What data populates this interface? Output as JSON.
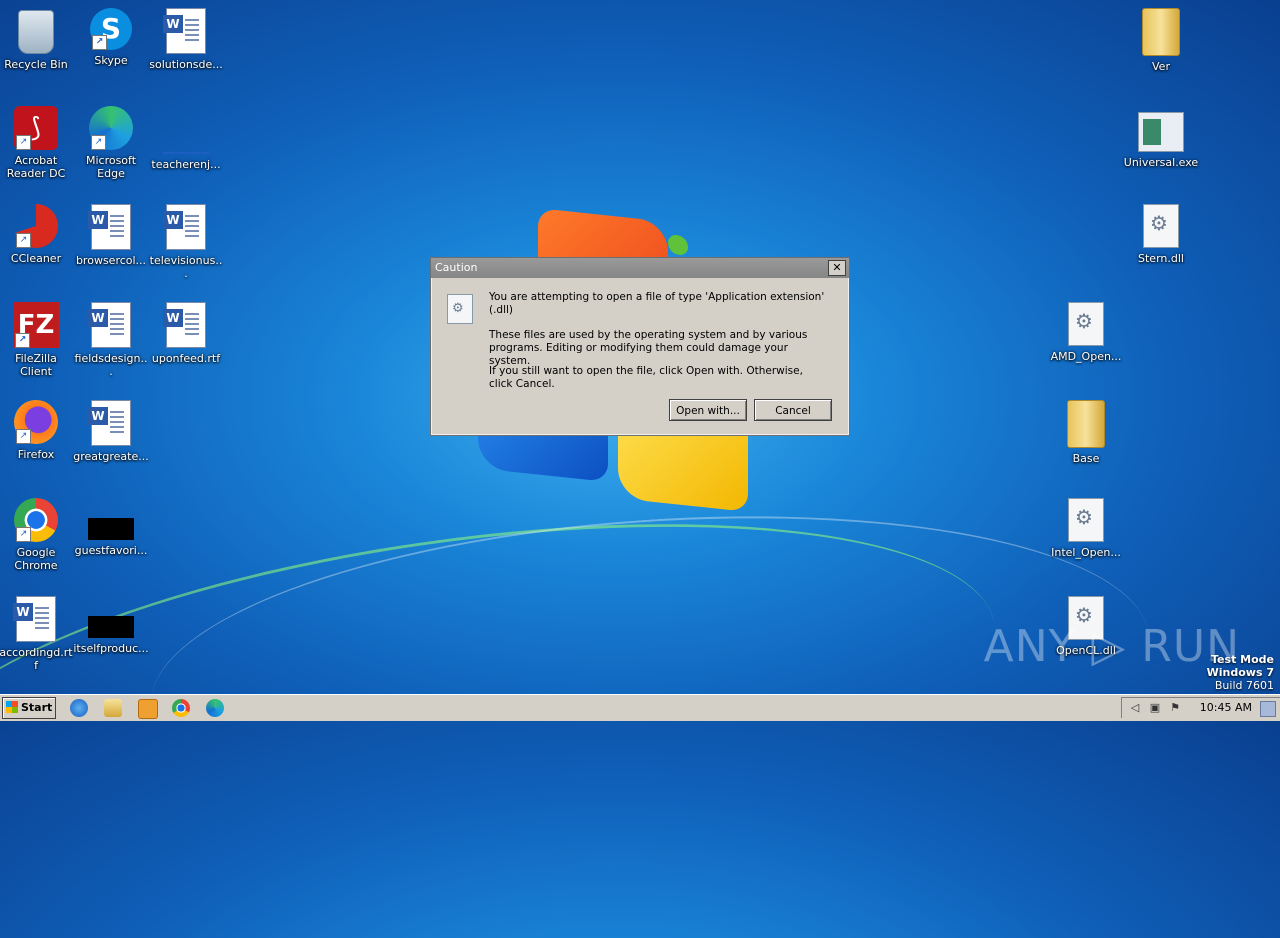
{
  "desktop": {
    "icons": [
      {
        "label": "Recycle Bin"
      },
      {
        "label": "Skype"
      },
      {
        "label": "solutionsde..."
      },
      {
        "label": "Acrobat Reader DC"
      },
      {
        "label": "Microsoft Edge"
      },
      {
        "label": "teacherenj..."
      },
      {
        "label": "CCleaner"
      },
      {
        "label": "browsercol..."
      },
      {
        "label": "televisionus..."
      },
      {
        "label": "FileZilla Client"
      },
      {
        "label": "fieldsdesign..."
      },
      {
        "label": "uponfeed.rtf"
      },
      {
        "label": "Firefox"
      },
      {
        "label": "greatgreate..."
      },
      {
        "label": "Google Chrome"
      },
      {
        "label": "guestfavori..."
      },
      {
        "label": "accordingd.rtf"
      },
      {
        "label": "itselfproduc..."
      },
      {
        "label": "Ver"
      },
      {
        "label": "Universal.exe"
      },
      {
        "label": "Stern.dll"
      },
      {
        "label": "AMD_Open..."
      },
      {
        "label": "Base"
      },
      {
        "label": "Intel_Open..."
      },
      {
        "label": "OpenCL.dll"
      }
    ]
  },
  "dialog": {
    "title": "Caution",
    "close_glyph": "✕",
    "line1": "You are attempting to open a file of type 'Application extension' (.dll)",
    "line2": "These files are used by the operating system and by various programs. Editing or modifying them could damage your system.",
    "line3": "If you still want to open the file, click Open with. Otherwise, click Cancel.",
    "open_with_label": "Open with...",
    "cancel_label": "Cancel"
  },
  "watermark": "ANY ▷ RUN",
  "test_mode": {
    "line1": "Test Mode",
    "line2": "Windows 7",
    "line3": "Build 7601"
  },
  "taskbar": {
    "start_label": "Start",
    "clock": "10:45 AM",
    "tray_icons": [
      "speaker-icon",
      "network-icon",
      "flag-icon"
    ],
    "quick_launch": [
      "ie-icon",
      "explorer-icon",
      "media-player-icon",
      "chrome-icon",
      "edge-icon"
    ]
  }
}
